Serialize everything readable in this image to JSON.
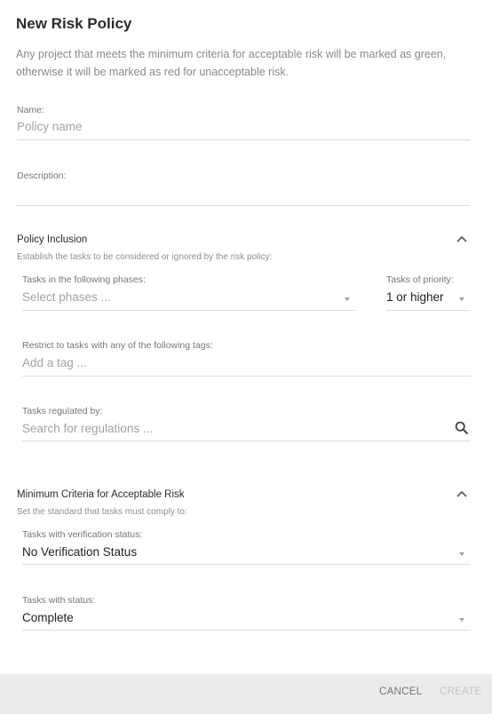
{
  "dialog": {
    "title": "New Risk Policy",
    "intro": "Any project that meets the minimum criteria for acceptable risk will be marked as green, otherwise it will be marked as red for unacceptable risk."
  },
  "name_field": {
    "label": "Name:",
    "placeholder": "Policy name"
  },
  "description_field": {
    "label": "Description:",
    "value": ""
  },
  "policy_inclusion": {
    "title": "Policy Inclusion",
    "subtitle": "Establish the tasks to be considered or ignored by the risk policy:",
    "phases": {
      "label": "Tasks in the following phases:",
      "placeholder": "Select phases ..."
    },
    "priority": {
      "label": "Tasks of priority:",
      "value": "1 or higher"
    },
    "tags": {
      "label": "Restrict to tasks with any of the following tags:",
      "placeholder": "Add a tag ..."
    },
    "regulations": {
      "label": "Tasks regulated by:",
      "placeholder": "Search for regulations ..."
    }
  },
  "minimum_criteria": {
    "title": "Minimum Criteria for Acceptable Risk",
    "subtitle": "Set the standard that tasks must comply to:",
    "verification": {
      "label": "Tasks with verification status:",
      "value": "No Verification Status"
    },
    "status": {
      "label": "Tasks with status:",
      "value": "Complete"
    }
  },
  "footer": {
    "cancel_label": "CANCEL",
    "create_label": "CREATE"
  },
  "colors": {
    "footer_bg": "#ebebeb",
    "disabled_text": "#c4c4c4",
    "placeholder_text": "#a3a3a3"
  }
}
